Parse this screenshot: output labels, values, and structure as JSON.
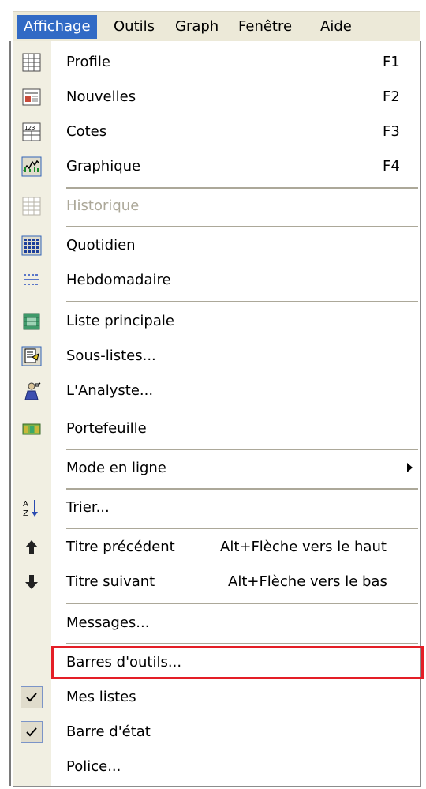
{
  "menubar": {
    "items": [
      "Affichage",
      "Outils",
      "Graph",
      "Fenêtre",
      "Aide"
    ],
    "active": "Affichage"
  },
  "menu": {
    "items": [
      {
        "label": "Profile",
        "shortcut": "F1",
        "icon": "grid-icon"
      },
      {
        "label": "Nouvelles",
        "shortcut": "F2",
        "icon": "newspaper-icon"
      },
      {
        "label": "Cotes",
        "shortcut": "F3",
        "icon": "quotes-table-icon"
      },
      {
        "label": "Graphique",
        "shortcut": "F4",
        "icon": "chart-icon"
      },
      {
        "label": "Historique",
        "shortcut": "",
        "icon": "history-grid-icon",
        "disabled": true
      },
      {
        "label": "Quotidien",
        "shortcut": "",
        "icon": "daily-icon"
      },
      {
        "label": "Hebdomadaire",
        "shortcut": "",
        "icon": "weekly-icon"
      },
      {
        "label": "Liste principale",
        "shortcut": "",
        "icon": "main-list-icon"
      },
      {
        "label": "Sous-listes...",
        "shortcut": "",
        "icon": "sublists-icon"
      },
      {
        "label": "L'Analyste...",
        "shortcut": "",
        "icon": "analyst-icon"
      },
      {
        "label": "Portefeuille",
        "shortcut": "",
        "icon": "portfolio-icon"
      },
      {
        "label": "Mode en ligne",
        "shortcut": "",
        "icon": "",
        "submenu": true
      },
      {
        "label": "Trier...",
        "shortcut": "",
        "icon": "sort-az-icon"
      },
      {
        "label": "Titre précédent",
        "shortcut": "Alt+Flèche vers le haut",
        "icon": "arrow-up-icon"
      },
      {
        "label": "Titre suivant",
        "shortcut": "Alt+Flèche vers le bas",
        "icon": "arrow-down-icon"
      },
      {
        "label": "Messages...",
        "shortcut": "",
        "icon": ""
      },
      {
        "label": "Barres d'outils...",
        "shortcut": "",
        "icon": "",
        "highlighted": true
      },
      {
        "label": "Mes listes",
        "shortcut": "",
        "icon": "checkmark-icon",
        "checked": true
      },
      {
        "label": "Barre d'état",
        "shortcut": "",
        "icon": "checkmark-icon",
        "checked": true
      },
      {
        "label": "Police...",
        "shortcut": "",
        "icon": ""
      }
    ]
  },
  "colors": {
    "menubar_bg": "#ece9d8",
    "active_bg": "#316ac5",
    "gutter_bg": "#f1efe2",
    "separator": "#aca899",
    "disabled_text": "#aca899",
    "highlight_border": "#e41e26"
  }
}
